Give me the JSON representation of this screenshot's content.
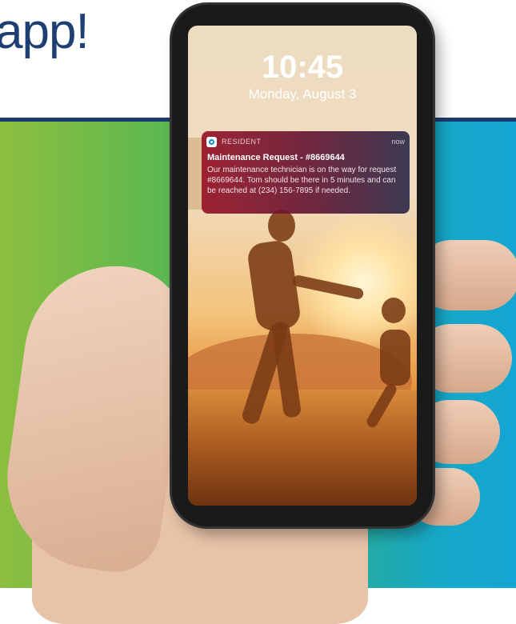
{
  "banner": {
    "headline": "app!"
  },
  "lock_screen": {
    "time": "10:45",
    "date": "Monday, August 3"
  },
  "notification": {
    "app_name": "RESIDENT",
    "timestamp": "now",
    "title": "Maintenance Request - #8669644",
    "body": "Our maintenance technician is on the way for request #8669644. Tom should be there in 5 minutes and can be reached at (234) 156-7895 if needed.",
    "app_icon": "resident-app-icon"
  },
  "colors": {
    "headline": "#1e3f73",
    "rule": "#1d3b6e",
    "gradient_left": "#8dbf3f",
    "gradient_right": "#14a6d3"
  }
}
